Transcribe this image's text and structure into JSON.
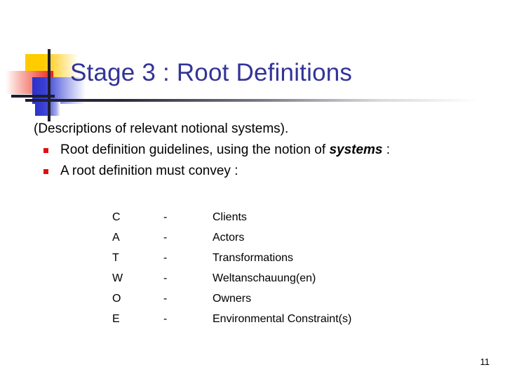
{
  "slide": {
    "title": "Stage 3 : Root Definitions",
    "page_number": "11",
    "title_color": "#333399",
    "bullet_color": "#e01010",
    "background_color": "#ffffff"
  },
  "logo": {
    "yellow_color": "#ffcc00",
    "red_color": "#e8241c",
    "blue_color": "#2b31c9",
    "bar_color": "#1d1d2e"
  },
  "body": {
    "lead_line": "(Descriptions of relevant notional systems).",
    "bullets": [
      {
        "text_before": "Root definition guidelines, using the notion of ",
        "emphasis": "systems",
        "text_after": " :"
      },
      {
        "text_before": "A root definition must convey :",
        "emphasis": "",
        "text_after": ""
      }
    ]
  },
  "catwoe": {
    "rows": [
      {
        "letter": "C",
        "dash": "-",
        "description": "Clients"
      },
      {
        "letter": "A",
        "dash": "-",
        "description": "Actors"
      },
      {
        "letter": "T",
        "dash": "-",
        "description": "Transformations"
      },
      {
        "letter": "W",
        "dash": "-",
        "description": "Weltanschauung(en)"
      },
      {
        "letter": "O",
        "dash": "-",
        "description": "Owners"
      },
      {
        "letter": "E",
        "dash": "-",
        "description": "Environmental Constraint(s)"
      }
    ]
  }
}
